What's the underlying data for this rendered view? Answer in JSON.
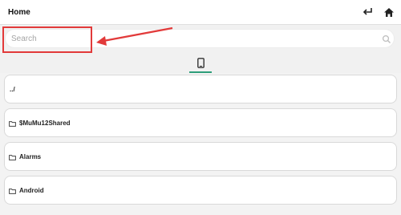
{
  "appbar": {
    "title": "Home",
    "back_icon": "back-arrow-icon",
    "home_icon": "home-icon"
  },
  "search": {
    "placeholder": "Search",
    "value": "",
    "icon": "search-icon"
  },
  "annotation": {
    "color": "#e23a3a"
  },
  "tabs": [
    {
      "icon": "phone-icon",
      "active": true,
      "accent": "#2e9e7a"
    }
  ],
  "files": [
    {
      "label": "../",
      "type": "parent"
    },
    {
      "label": "$MuMu12Shared",
      "type": "folder"
    },
    {
      "label": "Alarms",
      "type": "folder"
    },
    {
      "label": "Android",
      "type": "folder"
    }
  ]
}
